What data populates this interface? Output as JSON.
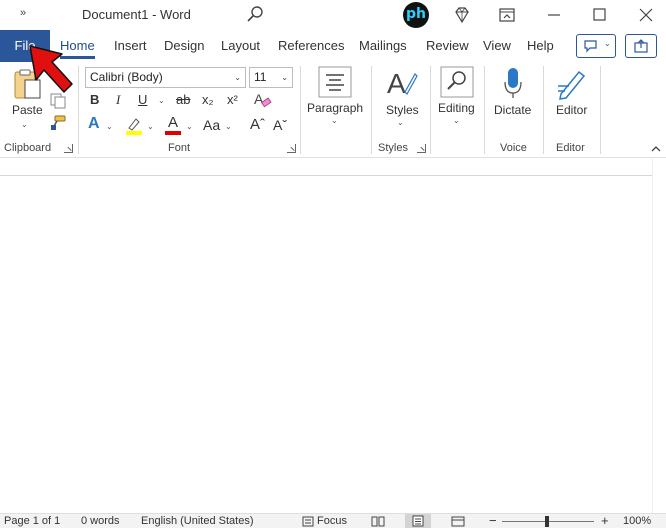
{
  "titlebar": {
    "overflow": "»",
    "title": "Document1  -  Word"
  },
  "tabs": {
    "file": "File",
    "items": [
      "Home",
      "Insert",
      "Design",
      "Layout",
      "References",
      "Mailings",
      "Review",
      "View",
      "Help"
    ],
    "active": "Home"
  },
  "ribbon": {
    "clipboard": {
      "paste": "Paste",
      "label": "Clipboard"
    },
    "font": {
      "font_name": "Calibri (Body)",
      "font_size": "11",
      "bold": "B",
      "italic": "I",
      "underline": "U",
      "strike": "ab",
      "subscript": "x₂",
      "superscript": "x²",
      "text_effects": "A",
      "highlight": "✎",
      "font_color": "A",
      "change_case": "Aa",
      "grow": "Aˆ",
      "shrink": "Aˇ",
      "label": "Font"
    },
    "paragraph": {
      "label_btn": "Paragraph"
    },
    "styles": {
      "btn": "Styles",
      "label": "Styles"
    },
    "editing": {
      "btn": "Editing"
    },
    "voice": {
      "btn": "Dictate",
      "label": "Voice"
    },
    "editor": {
      "btn": "Editor",
      "label": "Editor"
    }
  },
  "status": {
    "page": "Page 1 of 1",
    "words": "0 words",
    "language": "English (United States)",
    "focus": "Focus",
    "zoom": "100%"
  },
  "colors": {
    "accent": "#2b579a",
    "highlight_yellow": "#ffff00",
    "font_red": "#e00000",
    "pointer_red": "#e01010"
  }
}
